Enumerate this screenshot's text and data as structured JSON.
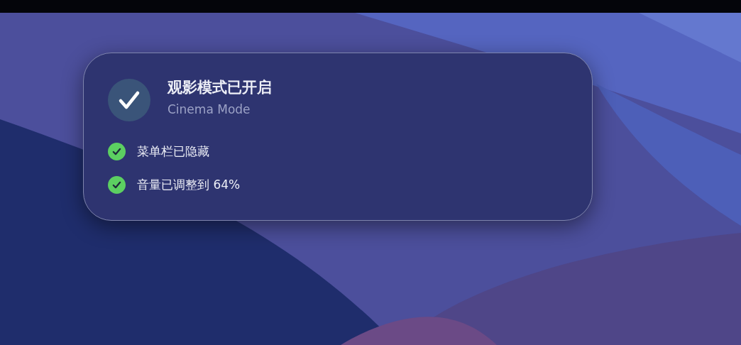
{
  "notification": {
    "title": "观影模式已开启",
    "subtitle": "Cinema Mode",
    "items": [
      {
        "label": "菜单栏已隐藏",
        "checked": true
      },
      {
        "label": "音量已调整到 64%",
        "checked": true
      }
    ]
  }
}
